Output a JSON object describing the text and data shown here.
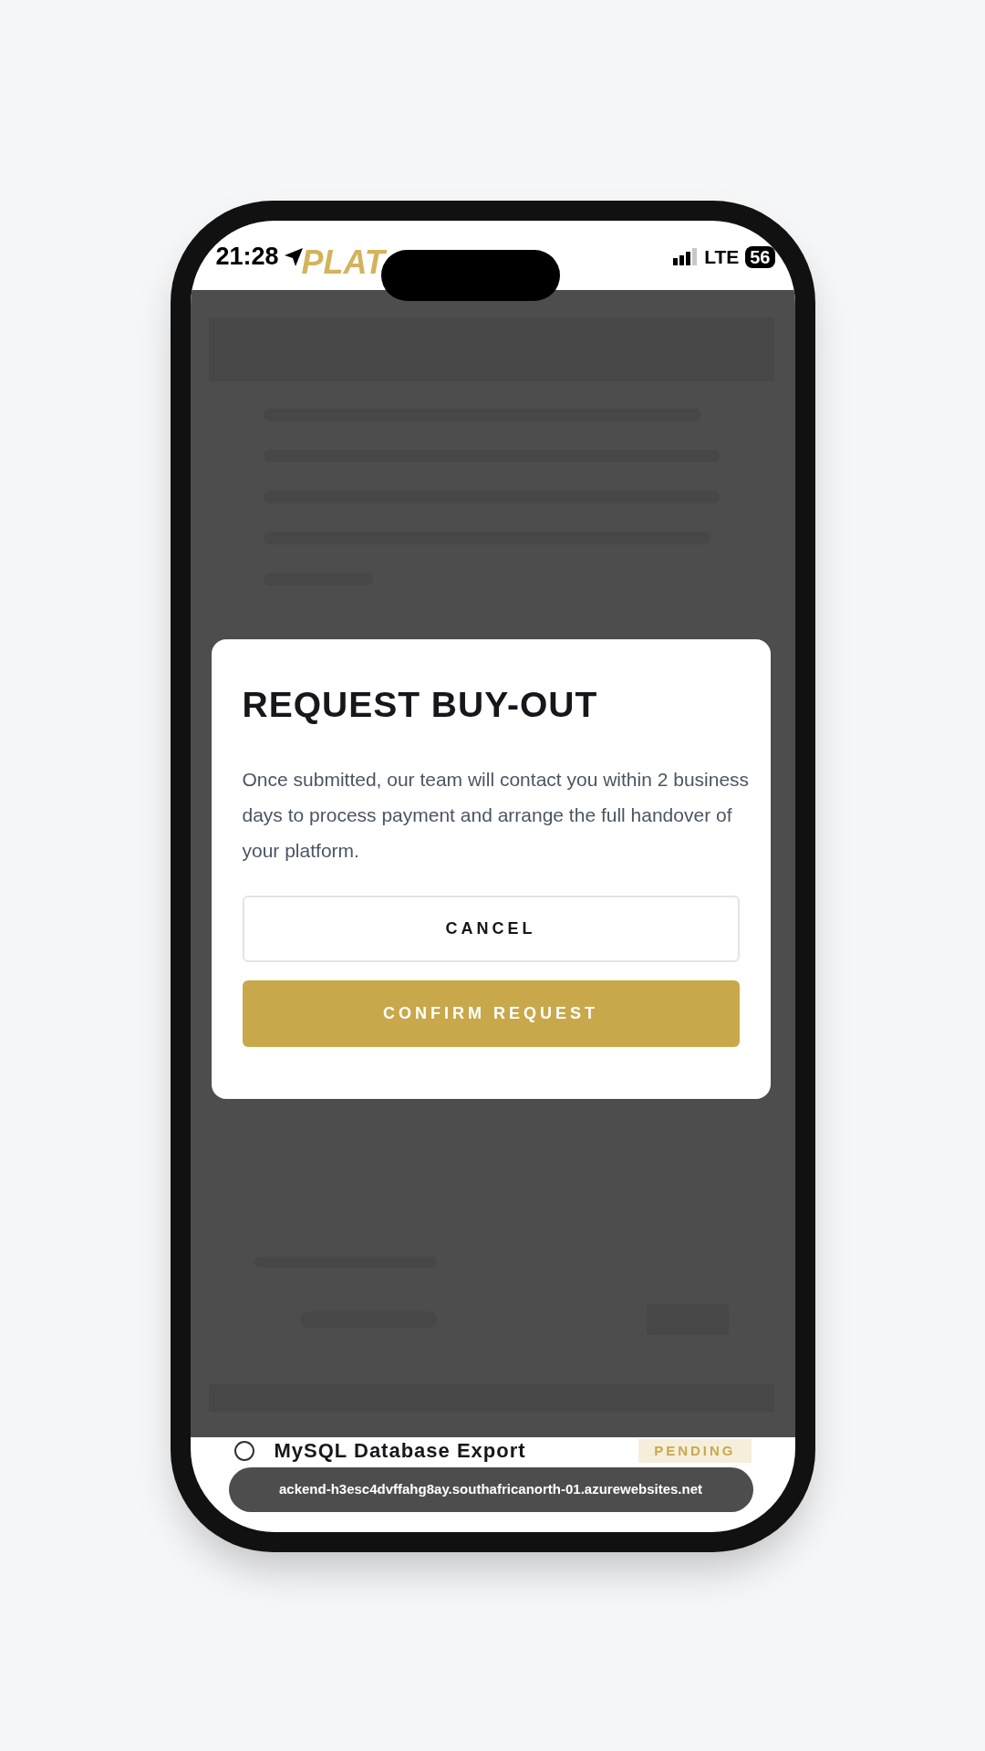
{
  "status_bar": {
    "time": "21:28",
    "network": "LTE",
    "battery": "56"
  },
  "logo_text": "PLAT",
  "modal": {
    "title": "REQUEST BUY-OUT",
    "message": "Once submitted, our team will contact you within 2 business days to process payment and arrange the full handover of your platform.",
    "buttons": [
      {
        "label": "CANCEL",
        "kind": "secondary"
      },
      {
        "label": "CONFIRM REQUEST",
        "kind": "primary"
      }
    ]
  },
  "list_item": {
    "title": "MySQL Database Export",
    "status": "PENDING",
    "checked": false
  },
  "url_bar": {
    "url": "ackend-h3esc4dvffahg8ay.southafricanorth-01.azurewebsites.net"
  }
}
